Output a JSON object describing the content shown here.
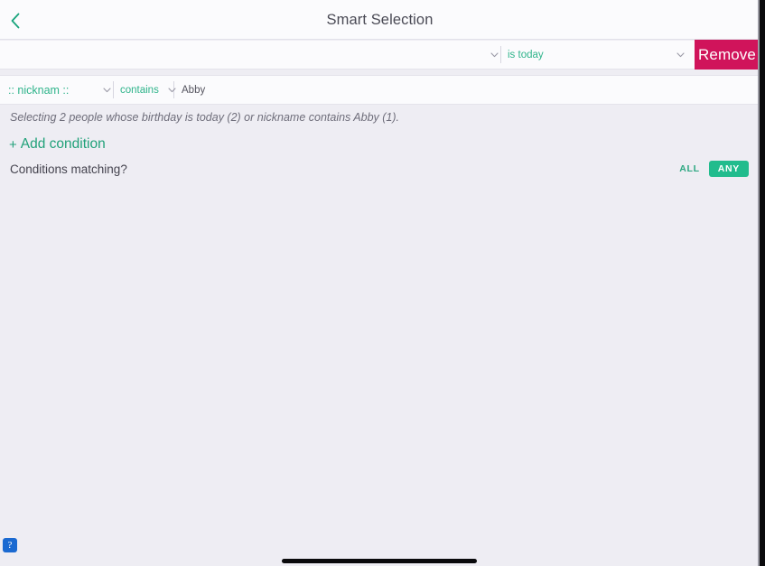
{
  "header": {
    "title": "Smart Selection",
    "back_icon": "chevron-left-icon"
  },
  "conditions": {
    "rows": [
      {
        "field_label": "",
        "field_chevron_icon": "chevron-down-icon",
        "operator_label": "is today",
        "operator_chevron_icon": "chevron-down-icon",
        "value_label": "",
        "remove_label": "Remove"
      },
      {
        "field_label": ":: nicknam ::",
        "field_chevron_icon": "chevron-down-icon",
        "operator_label": "contains",
        "operator_chevron_icon": "chevron-down-icon",
        "value_label": "Abby"
      }
    ]
  },
  "summary": {
    "text": "Selecting 2 people whose birthday is today (2) or nickname contains Abby (1)."
  },
  "add_condition": {
    "plus_icon": "plus-icon",
    "label": "Add condition"
  },
  "matching": {
    "label": "Conditions matching?",
    "options": [
      {
        "label": "ALL",
        "selected": false
      },
      {
        "label": "ANY",
        "selected": true
      }
    ]
  },
  "help": {
    "label": "?",
    "icon": "question-mark-badge-icon"
  },
  "colors": {
    "accent_green": "#21BC8D",
    "accent_teal_text": "#2FB48B",
    "remove_crimson": "#D0145B",
    "page_background": "#EEEDF3",
    "row_background": "#FBFBFD",
    "help_blue": "#1B6AD1"
  }
}
